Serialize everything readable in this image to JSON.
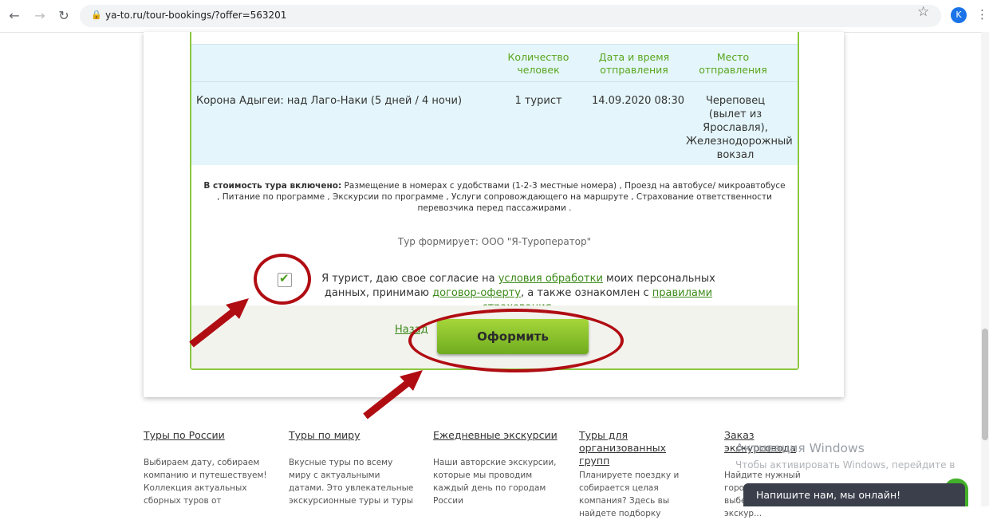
{
  "browser": {
    "url": "ya-to.ru/tour-bookings/?offer=563201",
    "avatar_letter": "K"
  },
  "table": {
    "headers": [
      "Количество человек",
      "Дата и время отправления",
      "Место отправления"
    ],
    "row": {
      "tour": "Корона Адыгеи: над Лаго-Наки (5 дней / 4 ночи)",
      "people": "1 турист",
      "datetime": "14.09.2020 08:30",
      "place": "Череповец (вылет из Ярославля), Железнодорожный вокзал"
    }
  },
  "included": {
    "label": "В стоимость тура включено:",
    "text": " Размещение в номерах с удобствами (1-2-3 местные номера) , Проезд на автобусе/ микроавтобусе , Питание по программе , Экскурсии по программе , Услуги сопровождающего на маршруте , Страхование ответственности перевозчика перед пассажирами ."
  },
  "operator": "Тур формирует: ООО \"Я-Туроператор\"",
  "consent": {
    "part1": "Я турист, даю свое согласие на ",
    "link1": "условия обработки",
    "part2": " моих персональных данных, принимаю ",
    "link2": "договор-оферту",
    "part3": ", а также ознакомлен с ",
    "link3": "правилами страхования",
    "part4": "."
  },
  "actions": {
    "back": "Назад",
    "submit": "Оформить"
  },
  "footer": [
    {
      "title": "Туры по России",
      "desc": "Выбираем дату, собираем компанию и путешествуем! Коллекция актуальных сборных туров от"
    },
    {
      "title": "Туры по миру",
      "desc": "Вкусные туры по всему миру с актуальными датами. Это увлекательные экскурсионные туры и туры"
    },
    {
      "title": "Ежедневные экскурсии",
      "desc": "Наши авторские экскурсии, которые мы проводим каждый день по городам России"
    },
    {
      "title": "Туры для организованных групп",
      "desc": "Планируете поездку и собирается целая компания? Здесь вы найдете подборку"
    },
    {
      "title": "Заказ экскурсовода",
      "desc": "Найдите нужный город на карте, выберите экску... экскур..."
    }
  ],
  "windows": {
    "title": "Активация Windows",
    "subtitle": "Чтобы активировать Windows, перейдите в"
  },
  "chat": {
    "label": "Напишите нам, мы онлайн!"
  },
  "colors": {
    "accent_green": "#8cc63f",
    "annotation_red": "#b00d12"
  }
}
